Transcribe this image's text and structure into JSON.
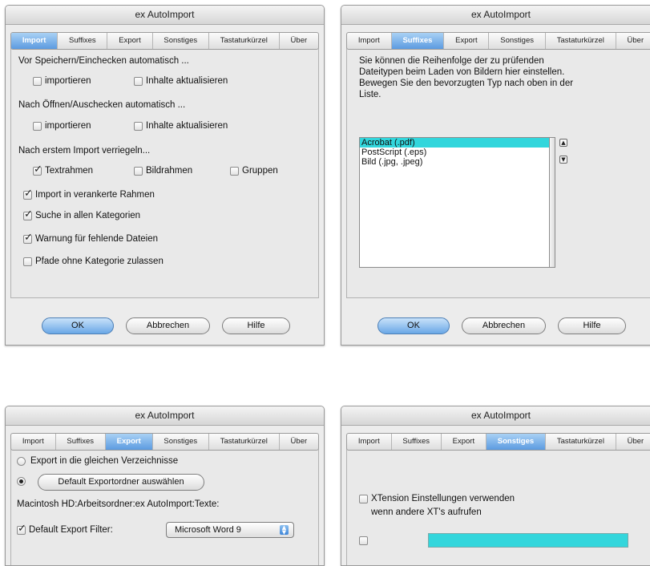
{
  "title": "ex AutoImport",
  "tabs": [
    "Import",
    "Suffixes",
    "Export",
    "Sonstiges",
    "Tastaturkürzel",
    "Über"
  ],
  "buttons": {
    "ok": "OK",
    "cancel": "Abbrechen",
    "help": "Hilfe"
  },
  "import_panel": {
    "section1": "Vor Speichern/Einchecken automatisch ...",
    "section1_import": "importieren",
    "section1_update": "Inhalte aktualisieren",
    "section1_import_checked": false,
    "section1_update_checked": false,
    "section2": "Nach Öffnen/Auschecken automatisch ...",
    "section2_import": "importieren",
    "section2_update": "Inhalte aktualisieren",
    "section2_import_checked": false,
    "section2_update_checked": false,
    "section3": "Nach erstem Import verriegeln...",
    "textframes": "Textrahmen",
    "textframes_checked": true,
    "imageframes": "Bildrahmen",
    "imageframes_checked": false,
    "groups": "Gruppen",
    "groups_checked": false,
    "anchored": "Import in verankerte Rahmen",
    "anchored_checked": true,
    "search_all": "Suche in allen Kategorien",
    "search_all_checked": true,
    "warn_missing": "Warnung für fehlende Dateien",
    "warn_missing_checked": true,
    "paths_no_cat": "Pfade ohne Kategorie zulassen",
    "paths_no_cat_checked": false
  },
  "suffixes_panel": {
    "description": "Sie können die Reihenfolge der zu prüfenden\nDateitypen beim Laden von Bildern hier einstellen.\nBewegen Sie den bevorzugten Typ nach oben in der\nListe.",
    "items": [
      "Acrobat (.pdf)",
      "PostScript (.eps)",
      "Bild (.jpg, .jpeg)"
    ],
    "selected_index": 0
  },
  "export_panel": {
    "same_dirs": "Export in die gleichen Verzeichnisse",
    "same_dirs_selected": false,
    "choose_button": "Default Exportordner auswählen",
    "choose_selected": true,
    "path": "Macintosh HD:Arbeitsordner:ex AutoImport:Texte:",
    "default_filter": "Default Export Filter:",
    "default_filter_checked": true,
    "filter_value": "Microsoft Word 9"
  },
  "other_panel": {
    "xtension_line1": "XTension Einstellungen verwenden",
    "xtension_line2": "wenn andere XT's aufrufen",
    "xtension_checked": false
  },
  "colors": {
    "selection": "#32d6dc",
    "active_tab": "#5c9be0"
  }
}
